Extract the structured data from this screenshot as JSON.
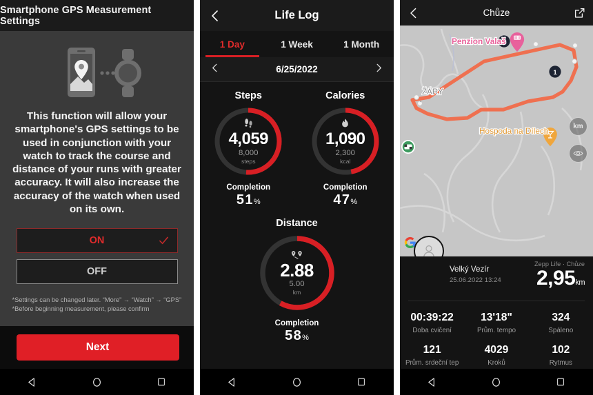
{
  "panel1": {
    "title": "Smartphone GPS Measurement Settings",
    "illustration_icon": "phone-gps-watch-illustration",
    "description": "This function will allow your smartphone's GPS settings to be used in conjunction with your watch to track the course and distance of your runs with greater accuracy. It will also increase the accuracy of the watch when used on its own.",
    "options": [
      {
        "label": "ON",
        "selected": true,
        "check_icon": "checkmark-icon"
      },
      {
        "label": "OFF",
        "selected": false
      }
    ],
    "note": "*Settings can be changed later. “More” → “Watch” → “GPS”\n*Before beginning measurement, please confirm",
    "next_label": "Next",
    "accent": "#e01f26",
    "on_text_color": "#e02b2b"
  },
  "panel2": {
    "back_icon": "chevron-left-icon",
    "title": "Life Log",
    "tabs": [
      {
        "label": "1 Day",
        "active": true
      },
      {
        "label": "1 Week",
        "active": false
      },
      {
        "label": "1 Month",
        "active": false
      }
    ],
    "date_prev_icon": "chevron-left-icon",
    "date_next_icon": "chevron-right-icon",
    "date": "6/25/2022",
    "metrics": [
      {
        "title": "Steps",
        "icon": "footprints-icon",
        "value": "4,059",
        "goal": "8,000",
        "unit": "steps",
        "completion_label": "Completion",
        "completion_value": "51",
        "completion_unit": "%",
        "percent": 51
      },
      {
        "title": "Calories",
        "icon": "flame-icon",
        "value": "1,090",
        "goal": "2,300",
        "unit": "kcal",
        "completion_label": "Completion",
        "completion_value": "47",
        "completion_unit": "%",
        "percent": 47
      },
      {
        "title": "Distance",
        "icon": "route-pins-icon",
        "value": "2.88",
        "goal": "5.00",
        "unit": "km",
        "completion_label": "Completion",
        "completion_value": "58",
        "completion_unit": "%",
        "percent": 58
      }
    ],
    "ring_track_color": "#333333",
    "ring_fill_color": "#d81f24"
  },
  "panel3": {
    "back_icon": "chevron-left-icon",
    "title": "Chůze",
    "share_icon": "external-link-icon",
    "map": {
      "route_color": "#ef7050",
      "background": "#c6c6c6",
      "labels": [
        {
          "text": "Penzion Valaš",
          "color": "#e8639b"
        },
        {
          "text": "ŽÁRY",
          "color": "#8a8a8a"
        },
        {
          "text": "Hospoda na Dílech",
          "color": "#e8a23a"
        }
      ],
      "markers": [
        {
          "label": "1",
          "type": "km-marker"
        },
        {
          "label": "2",
          "type": "km-marker"
        }
      ],
      "poi_icons": [
        "restaurant-pin-icon",
        "bar-pin-icon"
      ],
      "km_button_label": "km",
      "eye_button_icon": "eye-icon",
      "attribution": "G"
    },
    "user_name": "Velký Vezír",
    "activity_date": "25.06.2022 13:24",
    "source": "Zepp Life · Chůze",
    "distance_value": "2,95",
    "distance_unit": "km",
    "stats": [
      {
        "value": "00:39:22",
        "label": "Doba cvičení"
      },
      {
        "value": "13'18\"",
        "label": "Prům. tempo"
      },
      {
        "value": "324",
        "label": "Spáleno"
      },
      {
        "value": "121",
        "label": "Prům. srdeční tep"
      },
      {
        "value": "4029",
        "label": "Kroků"
      },
      {
        "value": "102",
        "label": "Rytmus"
      }
    ]
  },
  "navbar": {
    "back_icon": "triangle-back-icon",
    "home_icon": "circle-home-icon",
    "recents_icon": "square-recents-icon"
  }
}
